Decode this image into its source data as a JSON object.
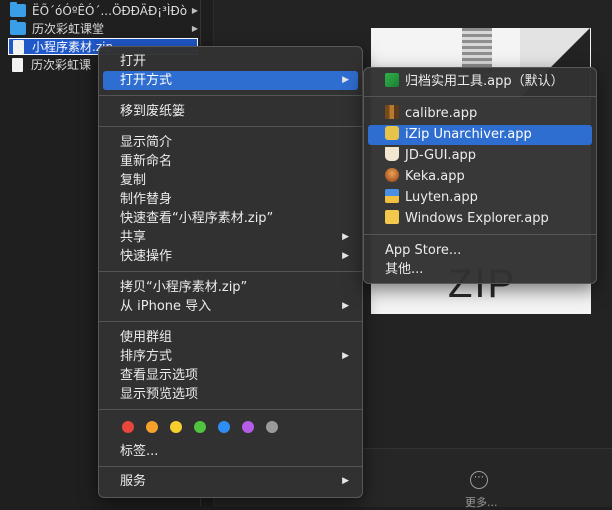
{
  "files": [
    {
      "name": "ËÕ´óÓºÊÓ´...ÖÐÐÄÐ¡³ÌÐò",
      "type": "folder",
      "has_arrow": true
    },
    {
      "name": "历次彩虹课堂",
      "type": "folder",
      "has_arrow": true
    },
    {
      "name": "小程序素材.zip",
      "type": "doc",
      "selected": true
    },
    {
      "name": "历次彩虹课",
      "type": "doc"
    }
  ],
  "preview": {
    "zip_text": "ZIP",
    "more_icon": "⋯",
    "more_label": "更多..."
  },
  "context_menu": {
    "items": {
      "open": "打开",
      "open_with": "打开方式",
      "move_to_trash": "移到废纸篓",
      "get_info": "显示简介",
      "rename": "重新命名",
      "duplicate": "复制",
      "make_alias": "制作替身",
      "quick_look": "快速查看“小程序素材.zip”",
      "share": "共享",
      "quick_actions": "快速操作",
      "copy": "拷贝“小程序素材.zip”",
      "import_iphone": "从 iPhone 导入",
      "use_groups": "使用群组",
      "sort_by": "排序方式",
      "show_view_options": "查看显示选项",
      "show_preview_options": "显示预览选项",
      "tags": "标签...",
      "services": "服务"
    },
    "submenu_arrow": "▶",
    "tag_colors": [
      "#e9463d",
      "#f5a12a",
      "#f5cf2b",
      "#50c43e",
      "#2d8df5",
      "#b55ce9",
      "#9a9a9a"
    ]
  },
  "open_with_menu": {
    "default_app": "归档实用工具.app（默认）",
    "apps": [
      "calibre.app",
      "iZip Unarchiver.app",
      "JD-GUI.app",
      "Keka.app",
      "Luyten.app",
      "Windows Explorer.app"
    ],
    "app_store": "App Store...",
    "other": "其他..."
  }
}
